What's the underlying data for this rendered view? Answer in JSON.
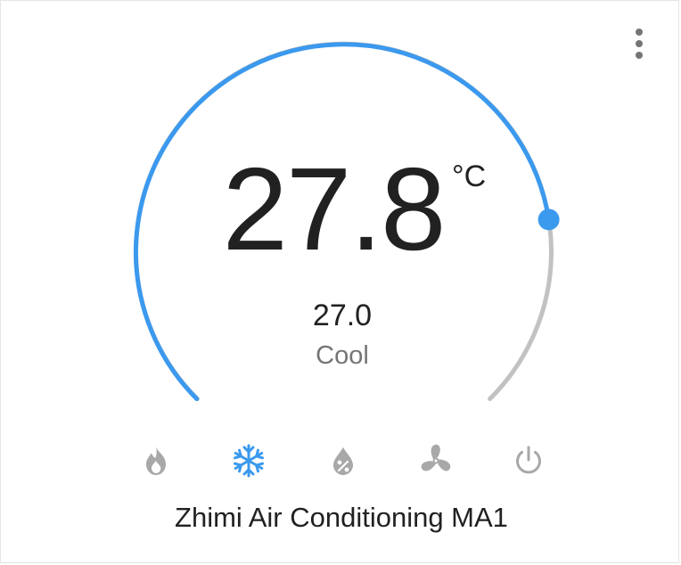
{
  "thermostat": {
    "current_temperature": "27.8",
    "unit": "°C",
    "target_temperature": "27.0",
    "hvac_mode": "Cool",
    "name": "Zhimi Air Conditioning MA1",
    "dial_level": 0.8
  },
  "modes": [
    {
      "name": "heat",
      "icon": "flame-icon",
      "active": false
    },
    {
      "name": "cool",
      "icon": "snowflake-icon",
      "active": true
    },
    {
      "name": "dry",
      "icon": "water-percent-icon",
      "active": false
    },
    {
      "name": "fan_only",
      "icon": "fan-icon",
      "active": false
    },
    {
      "name": "off",
      "icon": "power-icon",
      "active": false
    }
  ],
  "menu": {
    "icon": "more-vertical-icon"
  },
  "colors": {
    "accent": "#3b99ee",
    "track": "#c2c2c2",
    "inactive_icon": "#a8a8a8",
    "text": "#212121",
    "secondary_text": "#757575"
  }
}
